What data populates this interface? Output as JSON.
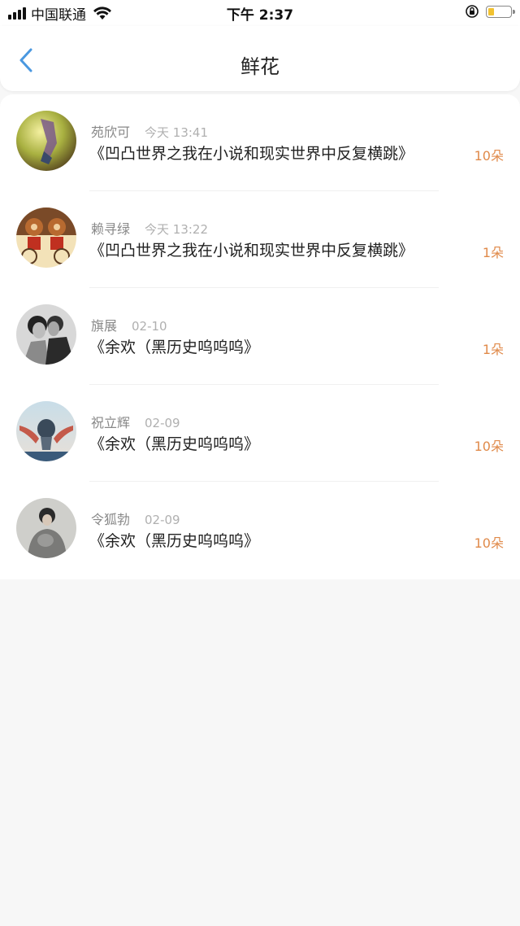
{
  "status_bar": {
    "carrier": "中国联通",
    "time": "下午 2:37"
  },
  "nav": {
    "title": "鲜花",
    "back_icon": "chevron-left-icon"
  },
  "colors": {
    "accent_back": "#4a98e0",
    "count": "#e08a4a",
    "battery": "#f2c230"
  },
  "items": [
    {
      "name": "苑欣可",
      "time": "今天 13:41",
      "book": "《凹凸世界之我在小说和现实世界中反复横跳》",
      "count": "10朵"
    },
    {
      "name": "赖寻绿",
      "time": "今天 13:22",
      "book": "《凹凸世界之我在小说和现实世界中反复横跳》",
      "count": "1朵"
    },
    {
      "name": "旗展",
      "time": "02-10",
      "book": "《余欢（黑历史呜呜呜》",
      "count": "1朵"
    },
    {
      "name": "祝立辉",
      "time": "02-09",
      "book": "《余欢（黑历史呜呜呜》",
      "count": "10朵"
    },
    {
      "name": "令狐勃",
      "time": "02-09",
      "book": "《余欢（黑历史呜呜呜》",
      "count": "10朵"
    }
  ]
}
